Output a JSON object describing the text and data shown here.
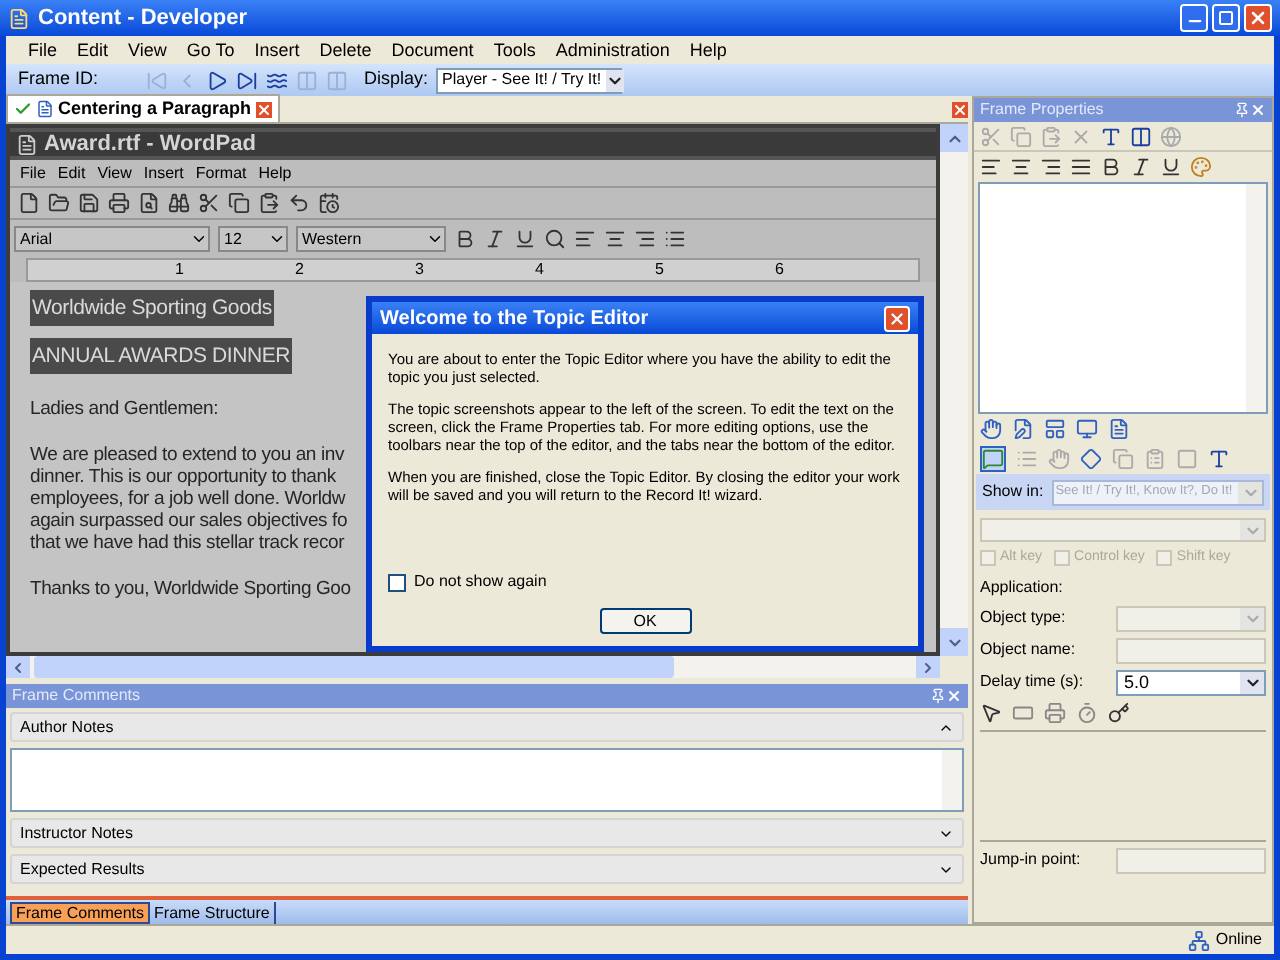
{
  "window": {
    "title": "Content - Developer"
  },
  "menu": [
    "File",
    "Edit",
    "View",
    "Go To",
    "Insert",
    "Delete",
    "Document",
    "Tools",
    "Administration",
    "Help"
  ],
  "toolbar": {
    "frame_id_label": "Frame ID:",
    "display_label": "Display:",
    "display_value": "Player - See It! / Try It!"
  },
  "document_tab": {
    "label": "Centering a Paragraph",
    "selected": true
  },
  "wordpad": {
    "title": "Award.rtf - WordPad",
    "menu": [
      "File",
      "Edit",
      "View",
      "Insert",
      "Format",
      "Help"
    ],
    "font": "Arial",
    "size": "12",
    "script": "Western",
    "ruler": [
      "1",
      "2",
      "3",
      "4",
      "5",
      "6"
    ],
    "headings": [
      "Worldwide Sporting Goods",
      "ANNUAL AWARDS DINNER"
    ],
    "paragraphs": [
      [
        "Ladies and Gentlemen:"
      ],
      [
        "We are pleased to extend to you an inv",
        "dinner.  This is our opportunity to thank",
        "employees, for a job well done.  Worldw",
        "again surpassed our sales objectives fo",
        "that we have had this stellar track recor"
      ],
      [
        "Thanks to you, Worldwide Sporting Goo"
      ]
    ]
  },
  "dialog": {
    "title": "Welcome to the Topic Editor",
    "paragraphs": [
      "You are about to enter the Topic Editor where you have the ability to edit the topic you just selected.",
      "The topic screenshots appear to the left of the screen. To edit the text on the screen, click the Frame Properties tab. For more editing options, use the toolbars near the top of the editor, and the tabs near the bottom of the editor.",
      "When you are finished, close the Topic Editor. By closing the editor your work will be saved and you will return to the Record It! wizard."
    ],
    "checkbox": {
      "label": "Do not show again",
      "checked": false
    },
    "button": "OK"
  },
  "frame_comments": {
    "title": "Frame Comments",
    "sections": [
      {
        "label": "Author Notes",
        "expanded": true
      },
      {
        "label": "Instructor Notes",
        "expanded": false
      },
      {
        "label": "Expected Results",
        "expanded": false
      }
    ]
  },
  "bottom_tabs": [
    {
      "label": "Frame Comments",
      "selected": true
    },
    {
      "label": "Frame Structure",
      "selected": false
    }
  ],
  "frame_properties": {
    "title": "Frame Properties",
    "show_in": {
      "label": "Show in:",
      "value": "See It! / Try It!, Know It?, Do It!",
      "disabled": true
    },
    "keys": [
      {
        "label": "Alt key",
        "checked": false,
        "disabled": true
      },
      {
        "label": "Control key",
        "checked": false,
        "disabled": true
      },
      {
        "label": "Shift key",
        "checked": false,
        "disabled": true
      }
    ],
    "application_label": "Application:",
    "fields": [
      {
        "label": "Object type:",
        "kind": "select",
        "disabled": true
      },
      {
        "label": "Object name:",
        "kind": "text",
        "disabled": true
      },
      {
        "label": "Delay time (s):",
        "kind": "select",
        "value": "5.0",
        "disabled": false
      }
    ],
    "jump_in_label": "Jump-in point:"
  },
  "status_bar": {
    "text": "Online"
  }
}
